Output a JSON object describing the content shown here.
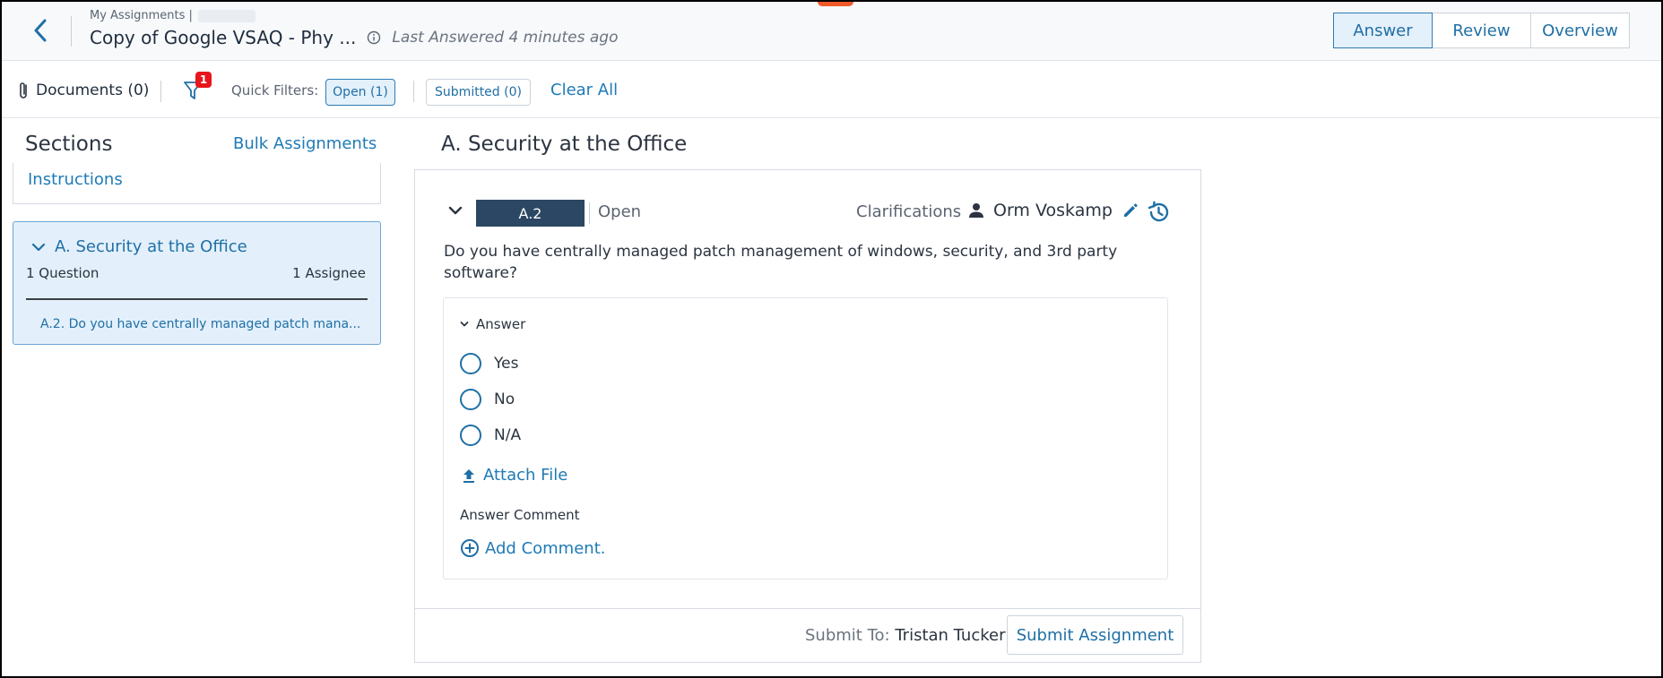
{
  "header": {
    "breadcrumb": "My Assignments |",
    "title": "Copy of Google VSAQ - Phy ...",
    "last_answered": "Last Answered 4 minutes ago",
    "tabs": [
      "Answer",
      "Review",
      "Overview"
    ],
    "active_tab": "Answer"
  },
  "toolbar": {
    "documents": "Documents (0)",
    "filter_badge": "1",
    "quick_filters_label": "Quick Filters:",
    "chip_open": "Open (1)",
    "chip_submitted": "Submitted (0)",
    "clear_all": "Clear All"
  },
  "sidebar": {
    "title": "Sections",
    "bulk_link": "Bulk Assignments",
    "instructions": "Instructions",
    "section": {
      "title": "A. Security at the Office",
      "question_count": "1 Question",
      "assignee_count": "1 Assignee",
      "question_preview": "A.2. Do you have centrally managed patch mana..."
    }
  },
  "main": {
    "heading": "A. Security at the Office",
    "question": {
      "id": "A.2",
      "status": "Open",
      "clarifications": "Clarifications",
      "assignee": "Orm Voskamp",
      "text": "Do you have centrally managed patch management of windows, security, and 3rd party software?"
    },
    "answer": {
      "label": "Answer",
      "options": [
        "Yes",
        "No",
        "N/A"
      ],
      "attach_file": "Attach File",
      "comment_label": "Answer Comment",
      "add_comment": "Add Comment."
    },
    "footer": {
      "submit_to_label": "Submit To:",
      "submit_to_name": "Tristan Tucker",
      "submit_button": "Submit Assignment"
    }
  },
  "colors": {
    "accent": "#1f7ab6",
    "pill": "#2c4763",
    "badge": "#e8151b",
    "selected_bg": "#e3f0fb"
  },
  "icons": [
    "back-chevron-icon",
    "info-icon",
    "paperclip-icon",
    "filter-icon",
    "chevron-down-icon",
    "person-icon",
    "pencil-icon",
    "history-icon",
    "upload-icon",
    "plus-circle-icon"
  ]
}
